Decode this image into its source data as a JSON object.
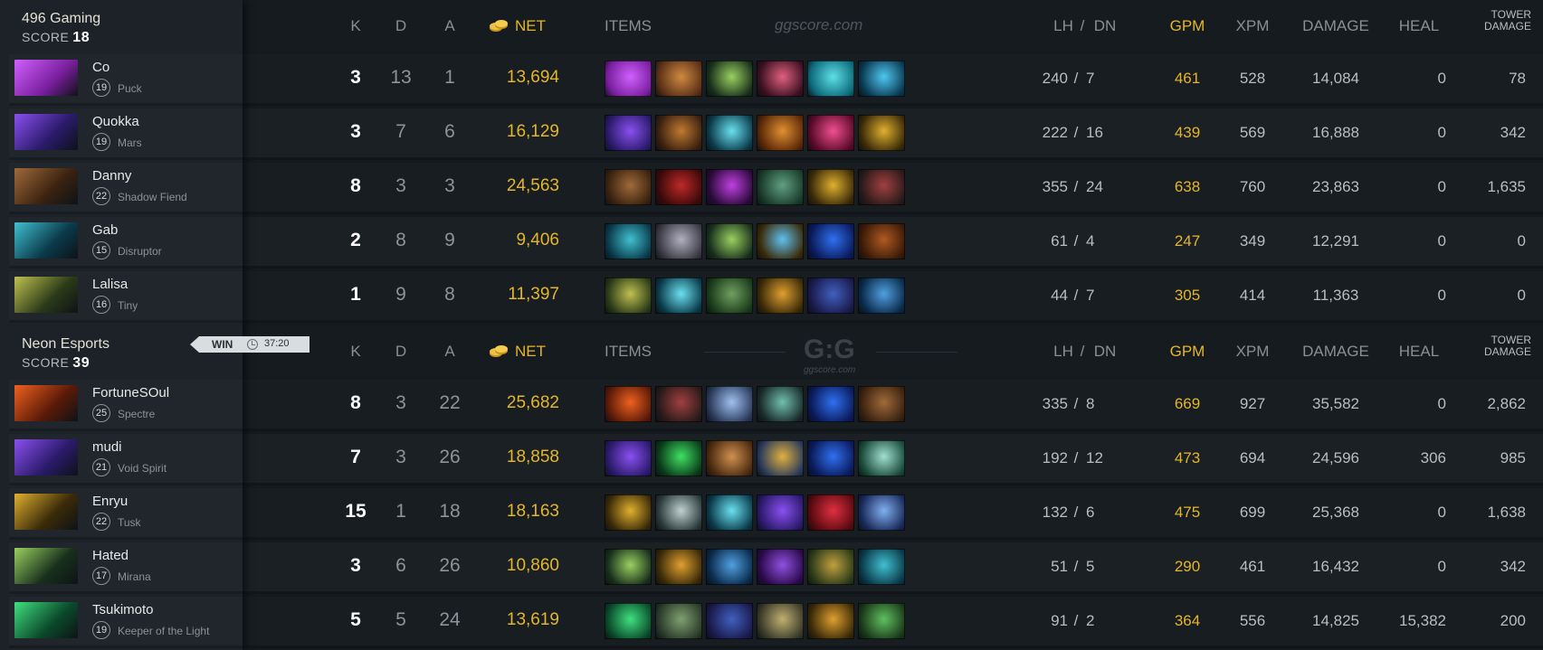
{
  "columns": {
    "k": "K",
    "d": "D",
    "a": "A",
    "net": "NET",
    "items": "ITEMS",
    "lh": "LH",
    "slash": "/",
    "dn": "DN",
    "gpm": "GPM",
    "xpm": "XPM",
    "damage": "DAMAGE",
    "heal": "HEAL",
    "tower_line1": "TOWER",
    "tower_line2": "DAMAGE"
  },
  "watermark": {
    "top": "ggscore.com",
    "big": "G:G",
    "small": "ggscore.com"
  },
  "result": {
    "label": "WIN",
    "duration": "37:20"
  },
  "colors": {
    "gold": "#e4b62a",
    "panel": "#1c2227",
    "row": "#181d22"
  },
  "teams": [
    {
      "name": "496 Gaming",
      "score_label": "SCORE",
      "score": "18",
      "players": [
        {
          "name": "Co",
          "level": "19",
          "hero": "Puck",
          "portrait": "puck-portrait",
          "k": "3",
          "d": "13",
          "a": "1",
          "net": "13,694",
          "lh": "240",
          "dn": "7",
          "gpm": "461",
          "xpm": "528",
          "damage": "14,084",
          "heal": "0",
          "tower": "78",
          "items": [
            [
              "#7a1f9e",
              "#d060ff"
            ],
            [
              "#5a3018",
              "#d08a40"
            ],
            [
              "#18301c",
              "#9ad060"
            ],
            [
              "#3a1020",
              "#e06080"
            ],
            [
              "#0d6a7a",
              "#5ee0e8"
            ],
            [
              "#0a3850",
              "#4ec8f0"
            ]
          ]
        },
        {
          "name": "Quokka",
          "level": "19",
          "hero": "Mars",
          "portrait": "mars-portrait",
          "k": "3",
          "d": "7",
          "a": "6",
          "net": "16,129",
          "lh": "222",
          "dn": "16",
          "gpm": "439",
          "xpm": "569",
          "damage": "16,888",
          "heal": "0",
          "tower": "342",
          "items": [
            [
              "#2a1a6a",
              "#8a50f0"
            ],
            [
              "#3a2010",
              "#c07a30"
            ],
            [
              "#0a3a4a",
              "#6ae0f0"
            ],
            [
              "#5a2808",
              "#e09030"
            ],
            [
              "#5a0a28",
              "#f05090"
            ],
            [
              "#3a2a08",
              "#e0b030"
            ]
          ]
        },
        {
          "name": "Danny",
          "level": "22",
          "hero": "Shadow Fiend",
          "portrait": "shadow-fiend-portrait",
          "k": "8",
          "d": "3",
          "a": "3",
          "net": "24,563",
          "lh": "355",
          "dn": "24",
          "gpm": "638",
          "xpm": "760",
          "damage": "23,863",
          "heal": "0",
          "tower": "1,635",
          "items": [
            [
              "#3a2210",
              "#a06a3a"
            ],
            [
              "#3a0a0a",
              "#c02828"
            ],
            [
              "#2a0a3a",
              "#c040e0"
            ],
            [
              "#1a3a2a",
              "#60a080"
            ],
            [
              "#3a2a08",
              "#e0b030"
            ],
            [
              "#2a1a1a",
              "#a04040"
            ]
          ]
        },
        {
          "name": "Gab",
          "level": "15",
          "hero": "Disruptor",
          "portrait": "disruptor-portrait",
          "k": "2",
          "d": "8",
          "a": "9",
          "net": "9,406",
          "lh": "61",
          "dn": "4",
          "gpm": "247",
          "xpm": "349",
          "damage": "12,291",
          "heal": "0",
          "tower": "0",
          "items": [
            [
              "#0a3a4a",
              "#40c0d0"
            ],
            [
              "#3a3a44",
              "#b0b0c0"
            ],
            [
              "#18301c",
              "#9ad060"
            ],
            [
              "#3a2a08",
              "#60c0f0"
            ],
            [
              "#0a1a5a",
              "#3070f0"
            ],
            [
              "#3a1a08",
              "#b05a20"
            ]
          ]
        },
        {
          "name": "Lalisa",
          "level": "16",
          "hero": "Tiny",
          "portrait": "tiny-portrait",
          "k": "1",
          "d": "9",
          "a": "8",
          "net": "11,397",
          "lh": "44",
          "dn": "7",
          "gpm": "305",
          "xpm": "414",
          "damage": "11,363",
          "heal": "0",
          "tower": "0",
          "items": [
            [
              "#2a3a18",
              "#c0c050"
            ],
            [
              "#0a3a4a",
              "#6ae0f0"
            ],
            [
              "#1a3a1a",
              "#70a060"
            ],
            [
              "#3a2a08",
              "#e0a030"
            ],
            [
              "#1a1a4a",
              "#4060c0"
            ],
            [
              "#0a2a4a",
              "#50a0e0"
            ]
          ]
        }
      ]
    },
    {
      "name": "Neon Esports",
      "score_label": "SCORE",
      "score": "39",
      "players": [
        {
          "name": "FortuneSOul",
          "level": "25",
          "hero": "Spectre",
          "portrait": "spectre-portrait",
          "k": "8",
          "d": "3",
          "a": "22",
          "net": "25,682",
          "lh": "335",
          "dn": "8",
          "gpm": "669",
          "xpm": "927",
          "damage": "35,582",
          "heal": "0",
          "tower": "2,862",
          "items": [
            [
              "#5a1a08",
              "#f06020"
            ],
            [
              "#2a1a1a",
              "#a04040"
            ],
            [
              "#2a3a5a",
              "#a0c0f0"
            ],
            [
              "#1a2a2a",
              "#70c0b0"
            ],
            [
              "#0a1a5a",
              "#3070f0"
            ],
            [
              "#3a2210",
              "#a06a3a"
            ]
          ]
        },
        {
          "name": "mudi",
          "level": "21",
          "hero": "Void Spirit",
          "portrait": "void-spirit-portrait",
          "k": "7",
          "d": "3",
          "a": "26",
          "net": "18,858",
          "lh": "192",
          "dn": "12",
          "gpm": "473",
          "xpm": "694",
          "damage": "24,596",
          "heal": "306",
          "tower": "985",
          "items": [
            [
              "#2a1a6a",
              "#8a50f0"
            ],
            [
              "#0a3a1a",
              "#40e060"
            ],
            [
              "#4a2a10",
              "#d09050"
            ],
            [
              "#2a3a5a",
              "#e0b040"
            ],
            [
              "#0a1a5a",
              "#3070f0"
            ],
            [
              "#1a4a3a",
              "#a0e0d0"
            ]
          ]
        },
        {
          "name": "Enryu",
          "level": "22",
          "hero": "Tusk",
          "portrait": "tusk-portrait",
          "k": "15",
          "d": "1",
          "a": "18",
          "net": "18,163",
          "lh": "132",
          "dn": "6",
          "gpm": "475",
          "xpm": "699",
          "damage": "25,368",
          "heal": "0",
          "tower": "1,638",
          "items": [
            [
              "#3a2a08",
              "#e0b030"
            ],
            [
              "#2a3a3a",
              "#c0d0d0"
            ],
            [
              "#0a3a4a",
              "#6ae0f0"
            ],
            [
              "#2a1a6a",
              "#8a50f0"
            ],
            [
              "#5a0a10",
              "#e03040"
            ],
            [
              "#1a2a5a",
              "#80b0f0"
            ]
          ]
        },
        {
          "name": "Hated",
          "level": "17",
          "hero": "Mirana",
          "portrait": "mirana-portrait",
          "k": "3",
          "d": "6",
          "a": "26",
          "net": "10,860",
          "lh": "51",
          "dn": "5",
          "gpm": "290",
          "xpm": "461",
          "damage": "16,432",
          "heal": "0",
          "tower": "342",
          "items": [
            [
              "#18301c",
              "#9ad060"
            ],
            [
              "#3a2a08",
              "#e0a030"
            ],
            [
              "#0a2a4a",
              "#50a0e0"
            ],
            [
              "#2a0a4a",
              "#9050e0"
            ],
            [
              "#2a3a18",
              "#c0a040"
            ],
            [
              "#0a3a4a",
              "#40c0d0"
            ]
          ]
        },
        {
          "name": "Tsukimoto",
          "level": "19",
          "hero": "Keeper of the Light",
          "portrait": "keeper-of-the-light-portrait",
          "k": "5",
          "d": "5",
          "a": "24",
          "net": "13,619",
          "lh": "91",
          "dn": "2",
          "gpm": "364",
          "xpm": "556",
          "damage": "14,825",
          "heal": "15,382",
          "tower": "200",
          "items": [
            [
              "#0a4a2a",
              "#40e080"
            ],
            [
              "#2a3a2a",
              "#80a070"
            ],
            [
              "#1a1a4a",
              "#4060c0"
            ],
            [
              "#3a3a2a",
              "#c0b070"
            ],
            [
              "#3a2a08",
              "#e0a030"
            ],
            [
              "#1a3a1a",
              "#60c060"
            ]
          ]
        }
      ]
    }
  ]
}
